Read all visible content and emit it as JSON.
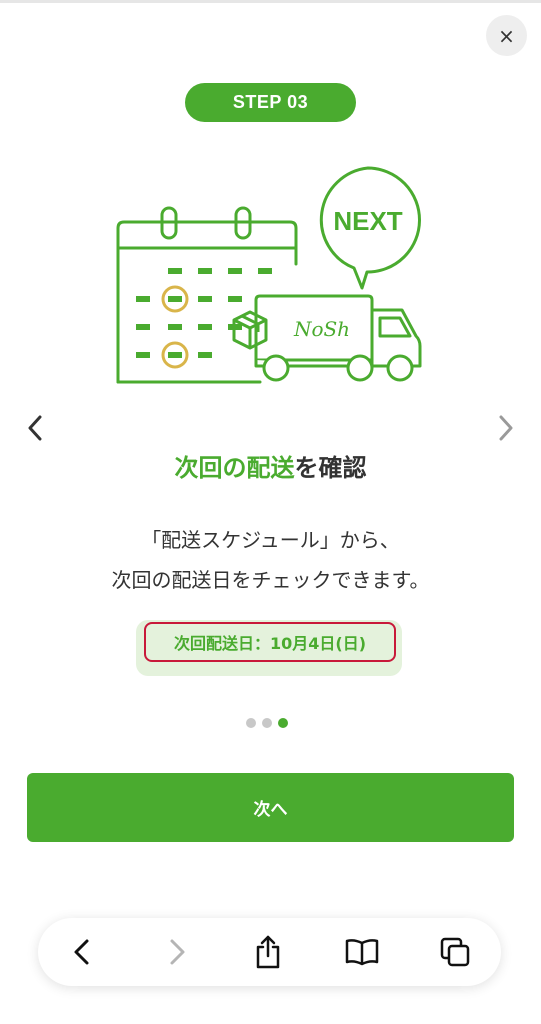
{
  "dialog": {
    "close_label": "×",
    "step_label": "STEP 03",
    "illustration": {
      "bubble_text": "NEXT",
      "truck_text": "NoSh"
    },
    "title": {
      "accent": "次回の配送",
      "rest": "を確認"
    },
    "description": [
      "「配送スケジュール」から、",
      "次回の配送日をチェックできます。"
    ],
    "next_delivery": "次回配送日：10月4日(日)",
    "pager": {
      "count": 3,
      "active_index": 2
    },
    "next_button_label": "次へ"
  },
  "browser_toolbar": {
    "buttons": [
      "back-icon",
      "forward-icon",
      "share-icon",
      "bookmarks-icon",
      "tabs-icon"
    ]
  },
  "colors": {
    "accent_green": "#4aab2f",
    "highlight_red": "#c8193a",
    "coin_gold": "#d9b54a",
    "pale_green": "#e4f2dc"
  }
}
